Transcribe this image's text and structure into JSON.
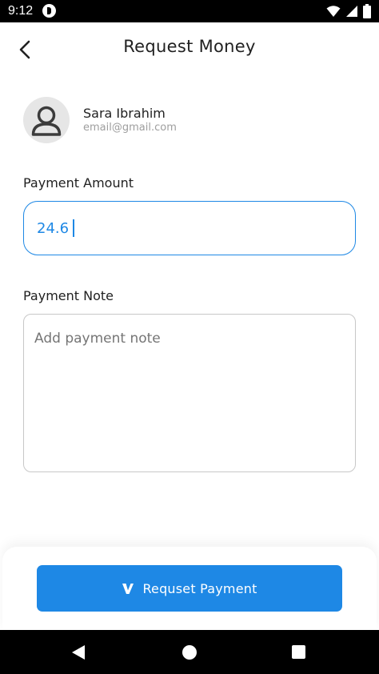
{
  "status_bar": {
    "time": "9:12",
    "icons": [
      "app-notification-icon",
      "wifi-icon",
      "cell-signal-icon",
      "battery-icon"
    ]
  },
  "header": {
    "title": "Request Money",
    "back_icon": "back-arrow-icon"
  },
  "contact": {
    "name": "Sara Ibrahim",
    "email": "email@gmail.com",
    "avatar_icon": "person-icon"
  },
  "form": {
    "amount_label": "Payment Amount",
    "amount_value": "24.6",
    "note_label": "Payment Note",
    "note_placeholder": "Add payment note"
  },
  "actions": {
    "request_label": "Requset Payment",
    "request_icon": "venmo-v-icon"
  },
  "nav_bar": {
    "icons": [
      "nav-back-icon",
      "nav-home-icon",
      "nav-recents-icon"
    ]
  },
  "colors": {
    "accent": "#1e88e5",
    "text": "#212121",
    "muted": "#9e9e9e",
    "border": "#c8c8c8"
  }
}
